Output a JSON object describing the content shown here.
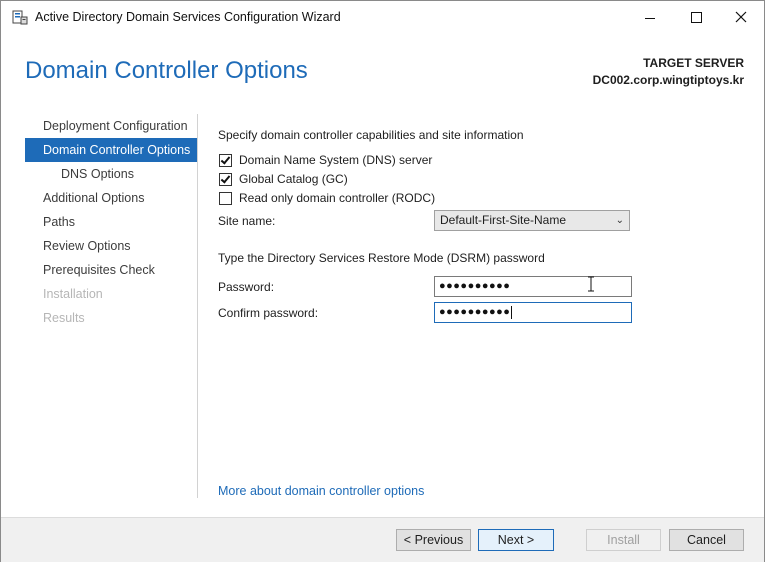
{
  "window": {
    "title": "Active Directory Domain Services Configuration Wizard"
  },
  "header": {
    "page_title": "Domain Controller Options",
    "target_label": "TARGET SERVER",
    "target_name": "DC002.corp.wingtiptoys.kr"
  },
  "nav": {
    "items": [
      {
        "label": "Deployment Configuration",
        "state": "normal"
      },
      {
        "label": "Domain Controller Options",
        "state": "active"
      },
      {
        "label": "DNS Options",
        "state": "sub"
      },
      {
        "label": "Additional Options",
        "state": "normal"
      },
      {
        "label": "Paths",
        "state": "normal"
      },
      {
        "label": "Review Options",
        "state": "normal"
      },
      {
        "label": "Prerequisites Check",
        "state": "normal"
      },
      {
        "label": "Installation",
        "state": "disabled"
      },
      {
        "label": "Results",
        "state": "disabled"
      }
    ]
  },
  "main": {
    "capabilities_heading": "Specify domain controller capabilities and site information",
    "checkboxes": [
      {
        "label": "Domain Name System (DNS) server",
        "checked": true
      },
      {
        "label": "Global Catalog (GC)",
        "checked": true
      },
      {
        "label": "Read only domain controller (RODC)",
        "checked": false
      }
    ],
    "site_name_label": "Site name:",
    "site_name_value": "Default-First-Site-Name",
    "dsrm_heading": "Type the Directory Services Restore Mode (DSRM) password",
    "password_label": "Password:",
    "password_value": "●●●●●●●●●●",
    "confirm_label": "Confirm password:",
    "confirm_value": "●●●●●●●●●●",
    "more_link": "More about domain controller options"
  },
  "footer": {
    "previous": "< Previous",
    "next": "Next >",
    "install": "Install",
    "cancel": "Cancel"
  },
  "colors": {
    "accent": "#1e6bb8"
  }
}
